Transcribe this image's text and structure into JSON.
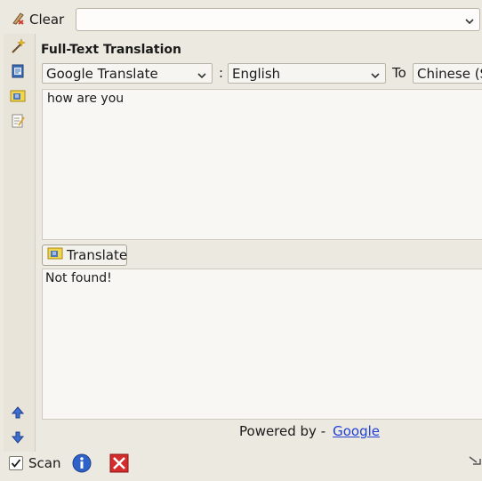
{
  "toolbar": {
    "clear_label": "Clear"
  },
  "history": {
    "value": ""
  },
  "panel": {
    "title": "Full-Text Translation"
  },
  "options": {
    "service": "Google Translate",
    "separator": ":",
    "source_language": "English",
    "to_label": "To",
    "target_language": "Chinese (S"
  },
  "source": {
    "text": "how are you"
  },
  "translate": {
    "label": "Translate"
  },
  "result": {
    "text": "Not found!"
  },
  "footer": {
    "powered_by": "Powered by -",
    "provider": "Google"
  },
  "bottom": {
    "scan_label": "Scan",
    "scan_checked": true
  },
  "icons": [
    "clear-icon",
    "wand-icon",
    "document-icon",
    "translate-icon",
    "notepad-icon",
    "arrow-up-icon",
    "arrow-down-icon",
    "info-icon",
    "close-icon",
    "resize-grip-icon"
  ]
}
